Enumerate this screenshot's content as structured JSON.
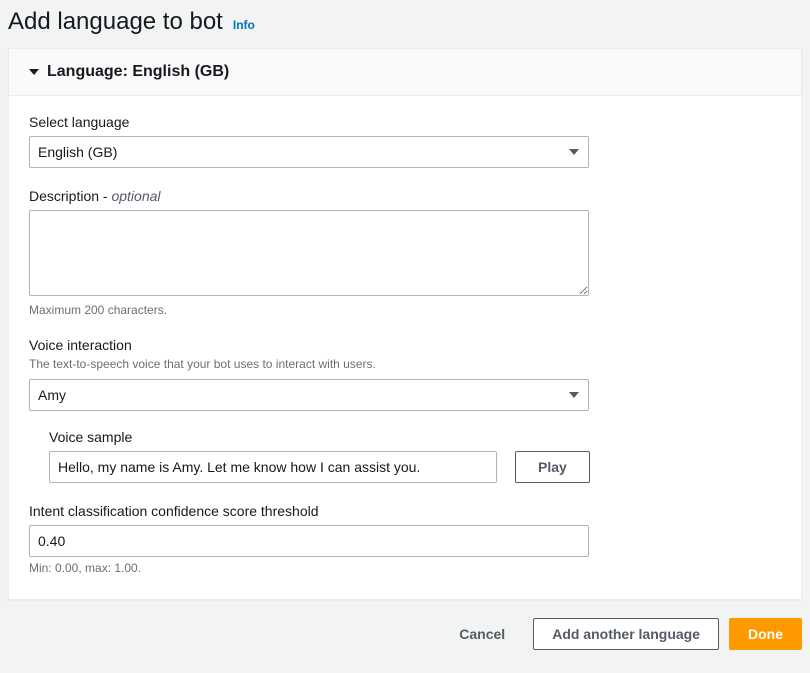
{
  "header": {
    "title": "Add language to bot",
    "info_label": "Info"
  },
  "panel": {
    "title": "Language: English (GB)"
  },
  "form": {
    "select_language": {
      "label": "Select language",
      "value": "English (GB)"
    },
    "description": {
      "label": "Description - ",
      "optional_suffix": "optional",
      "value": "",
      "helper": "Maximum 200 characters."
    },
    "voice_interaction": {
      "label": "Voice interaction",
      "helper_top": "The text-to-speech voice that your bot uses to interact with users.",
      "value": "Amy"
    },
    "voice_sample": {
      "label": "Voice sample",
      "value": "Hello, my name is Amy. Let me know how I can assist you.",
      "play_label": "Play"
    },
    "threshold": {
      "label": "Intent classification confidence score threshold",
      "value": "0.40",
      "helper": "Min: 0.00, max: 1.00."
    }
  },
  "footer": {
    "cancel": "Cancel",
    "add_another": "Add another language",
    "done": "Done"
  }
}
